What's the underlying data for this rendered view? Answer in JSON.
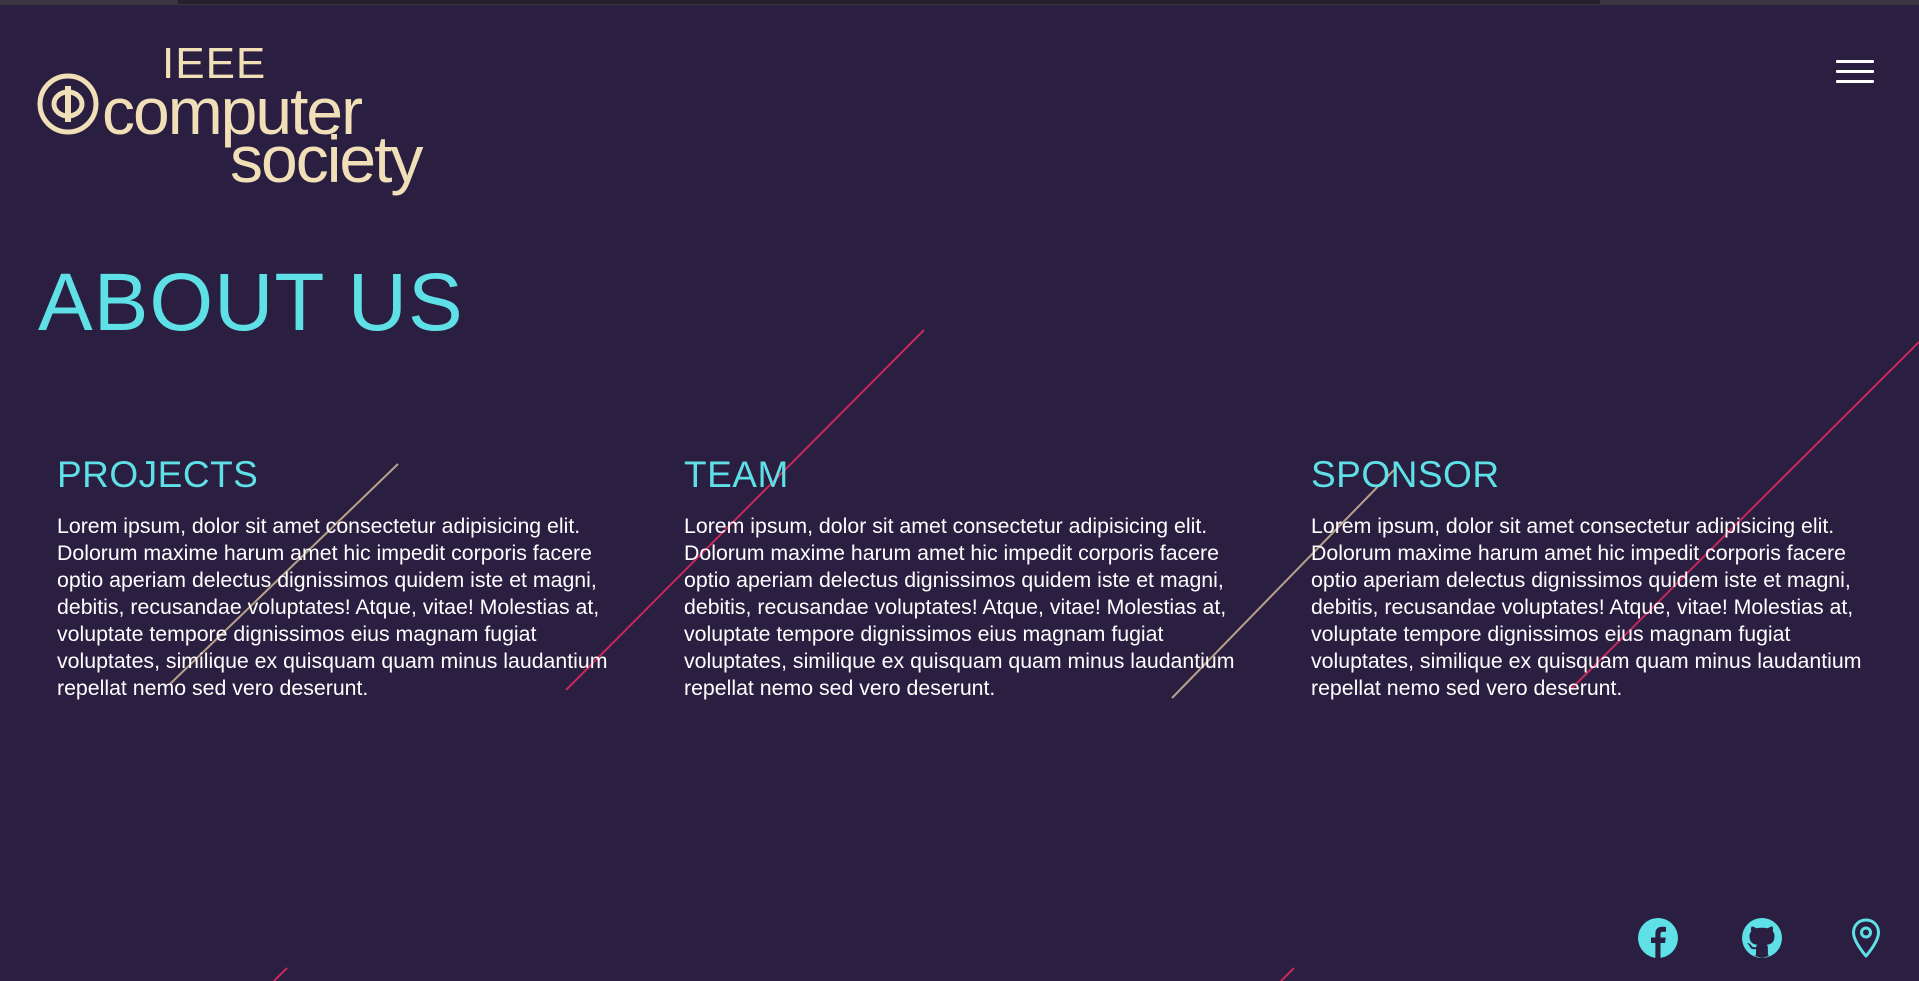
{
  "header": {
    "logo": {
      "line1": "IEEE",
      "line2": "computer",
      "line3": "society"
    },
    "menu_icon": "hamburger-menu-icon"
  },
  "main": {
    "title": "ABOUT US",
    "sections": [
      {
        "heading": "PROJECTS",
        "body": "Lorem ipsum, dolor sit amet consectetur adipisicing elit. Dolorum maxime harum amet hic impedit corporis facere optio aperiam delectus dignissimos quidem iste et magni, debitis, recusandae voluptates! Atque, vitae! Molestias at, voluptate tempore dignissimos eius magnam fugiat voluptates, similique ex quisquam quam minus laudantium repellat nemo sed vero deserunt."
      },
      {
        "heading": "TEAM",
        "body": "Lorem ipsum, dolor sit amet consectetur adipisicing elit. Dolorum maxime harum amet hic impedit corporis facere optio aperiam delectus dignissimos quidem iste et magni, debitis, recusandae voluptates! Atque, vitae! Molestias at, voluptate tempore dignissimos eius magnam fugiat voluptates, similique ex quisquam quam minus laudantium repellat nemo sed vero deserunt."
      },
      {
        "heading": "SPONSOR",
        "body": "Lorem ipsum, dolor sit amet consectetur adipisicing elit. Dolorum maxime harum amet hic impedit corporis facere optio aperiam delectus dignissimos quidem iste et magni, debitis, recusandae voluptates! Atque, vitae! Molestias at, voluptate tempore dignissimos eius magnam fugiat voluptates, similique ex quisquam quam minus laudantium repellat nemo sed vero deserunt."
      }
    ]
  },
  "footer": {
    "social_icons": [
      "facebook-icon",
      "github-icon",
      "location-pin-icon"
    ]
  },
  "colors": {
    "background": "#2a1e41",
    "accent_cyan": "#5ee0e6",
    "logo_cream": "#f1dfb8",
    "streak_pink": "#c8285a",
    "streak_tan": "#b8a28a"
  }
}
